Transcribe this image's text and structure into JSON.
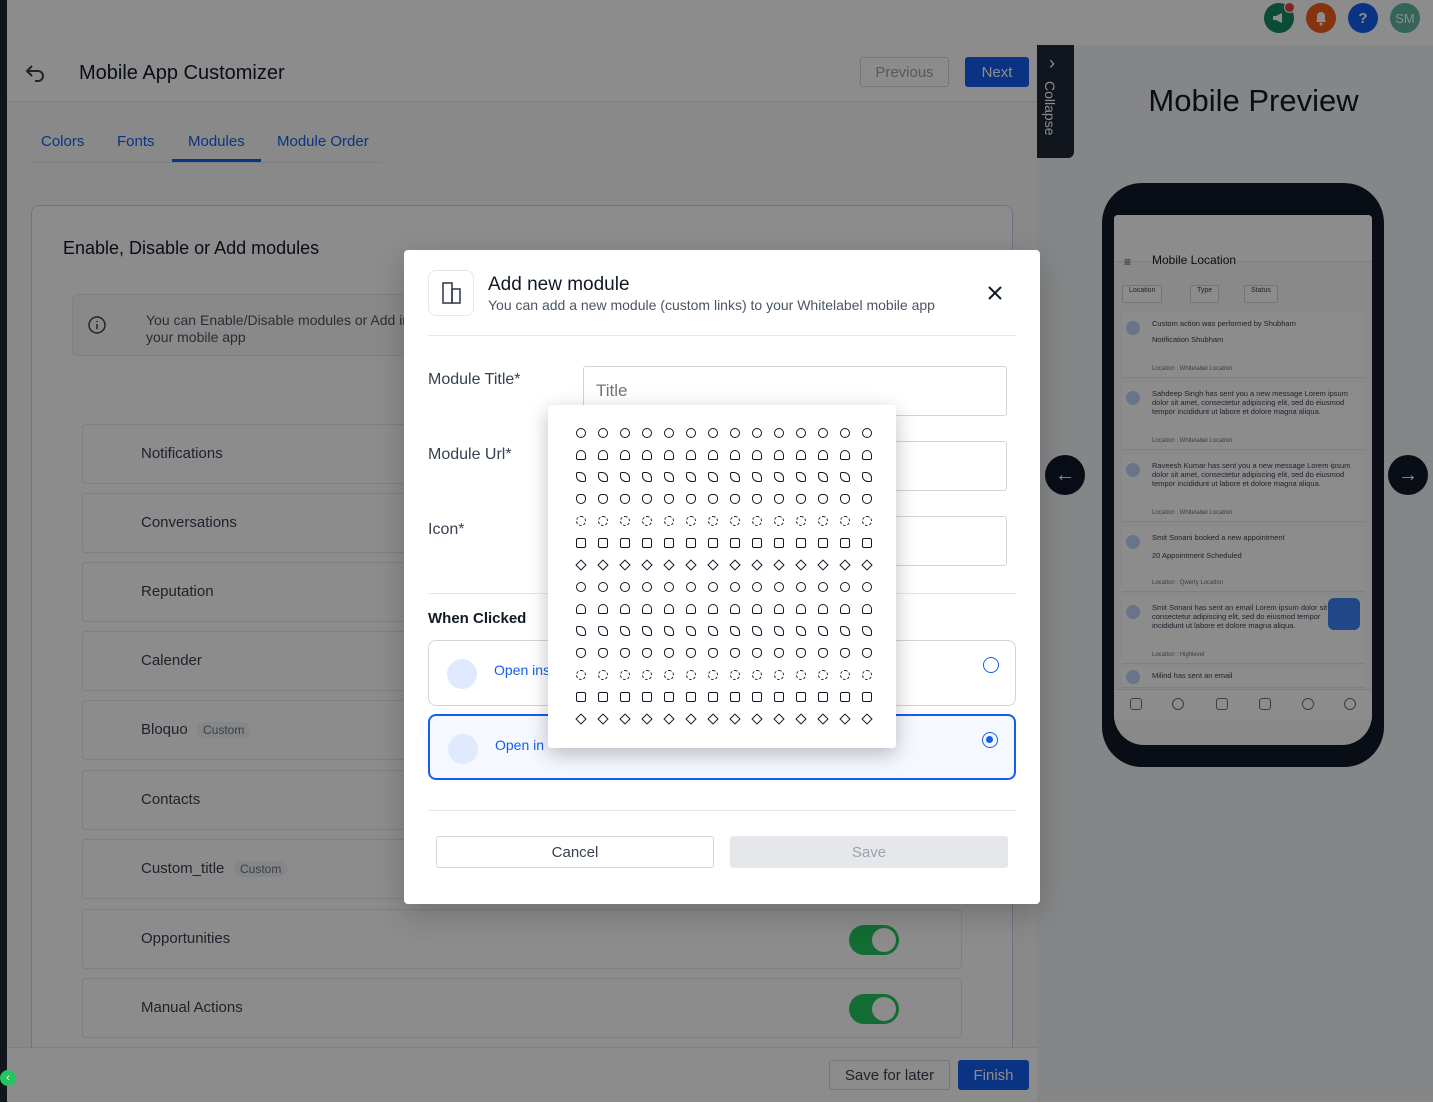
{
  "topbar": {
    "avatar_initials": "SM",
    "help_label": "?",
    "icons": [
      "megaphone-icon",
      "bell-icon",
      "help-icon",
      "avatar"
    ],
    "colors": {
      "megaphone": "#188b5f",
      "bell": "#f25f1c",
      "help": "#155eef",
      "avatar": "#5eb8a0"
    }
  },
  "header": {
    "title": "Mobile App Customizer",
    "previous_label": "Previous",
    "next_label": "Next"
  },
  "tabs": [
    {
      "label": "Colors"
    },
    {
      "label": "Fonts"
    },
    {
      "label": "Modules",
      "active": true
    },
    {
      "label": "Module Order"
    }
  ],
  "modules_card": {
    "title": "Enable, Disable or Add modules",
    "info_text": "You can Enable/Disable modules or Add in your mobile app",
    "rows": [
      {
        "label": "Notifications",
        "badge": ""
      },
      {
        "label": "Conversations",
        "badge": ""
      },
      {
        "label": "Reputation",
        "badge": ""
      },
      {
        "label": "Calender",
        "badge": ""
      },
      {
        "label": "Bloquo",
        "badge": "Custom"
      },
      {
        "label": "Contacts",
        "badge": ""
      },
      {
        "label": "Custom_title",
        "badge": "Custom"
      },
      {
        "label": "Opportunities",
        "badge": "",
        "enabled": true
      },
      {
        "label": "Manual Actions",
        "badge": "",
        "enabled": true
      }
    ]
  },
  "footer": {
    "save_later_label": "Save for later",
    "finish_label": "Finish"
  },
  "collapse_label": "Collapse",
  "preview": {
    "title": "Mobile Preview",
    "screen_title": "Mobile Location",
    "filters": [
      "Location",
      "Type",
      "Status"
    ],
    "notifications": [
      {
        "text": "Custom action was performed by Shubham",
        "sub": "Notification Shubham",
        "location": "Location : Whitelabel Location"
      },
      {
        "text": "Sahdeep Singh has sent you a new message Lorem ipsum dolor sit amet, consectetur adipiscing elit, sed do eiusmod tempor incididunt ut labore et dolore magna aliqua.",
        "sub": "",
        "location": "Location : Whitelabel Location"
      },
      {
        "text": "Raveesh Kumar has sent you a new message Lorem ipsum dolor sit amet, consectetur adipiscing elit, sed do eiusmod tempor incididunt ut labore et dolore magna aliqua.",
        "sub": "",
        "location": "Location : Whitelabel Location"
      },
      {
        "text": "Smit Sonani booked a new appointment",
        "sub": "20 Appointment Scheduled",
        "location": "Location : Qwerty Location"
      },
      {
        "text": "Smit Sonani has sent an email Lorem ipsum dolor sit amet, consectetur adipiscing elit, sed do eiusmod tempor incididunt ut labore et dolore magna aliqua.",
        "sub": "",
        "location": "Location : Highlevel"
      },
      {
        "text": "Milind has sent an email",
        "sub": "",
        "location": ""
      }
    ]
  },
  "modal": {
    "title": "Add new module",
    "subtitle": "You can add a new module (custom links) to your Whitelabel mobile app",
    "title_label": "Module Title*",
    "title_placeholder": "Title",
    "url_label": "Module Url*",
    "icon_label": "Icon*",
    "when_clicked_label": "When Clicked",
    "option1_label": "Open ins",
    "option2_label": "Open in",
    "selected_option": 2,
    "cancel_label": "Cancel",
    "save_label": "Save"
  },
  "icon_picker": {
    "rows": 14,
    "columns": 14
  }
}
